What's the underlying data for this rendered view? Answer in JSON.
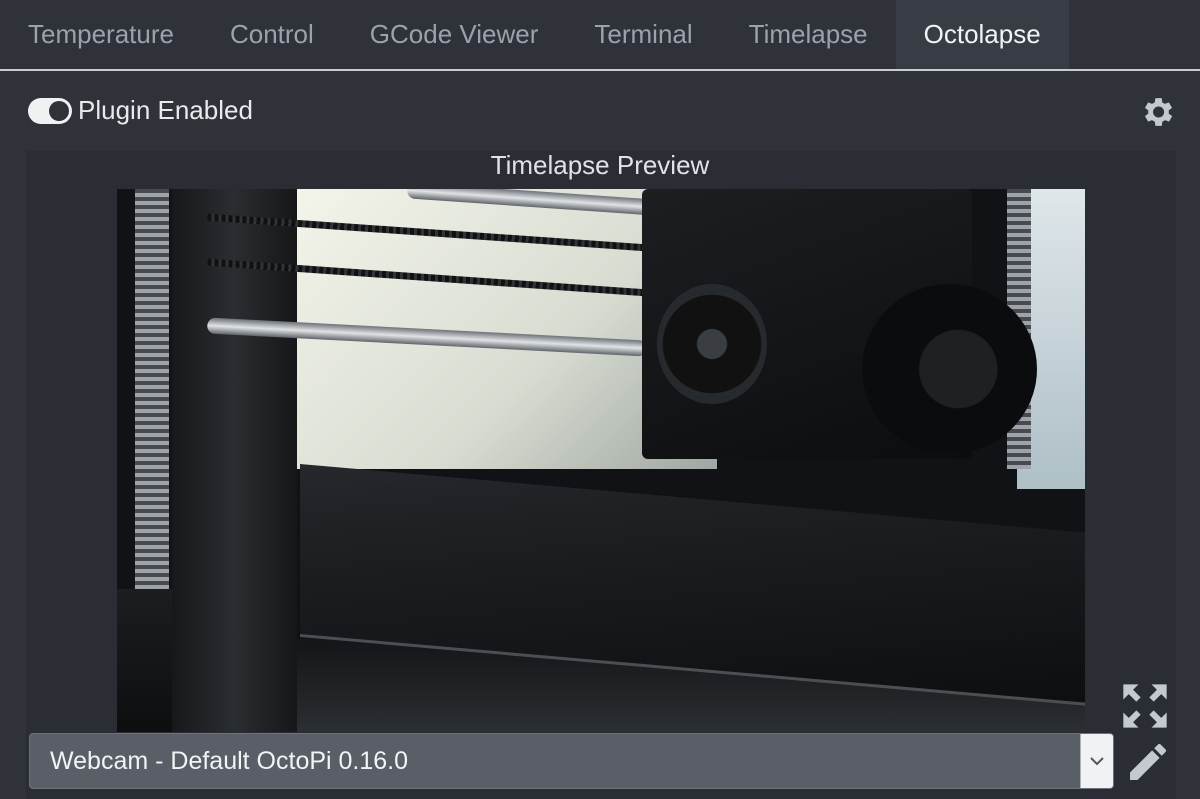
{
  "tabs": [
    {
      "label": "Temperature",
      "active": false
    },
    {
      "label": "Control",
      "active": false
    },
    {
      "label": "GCode Viewer",
      "active": false
    },
    {
      "label": "Terminal",
      "active": false
    },
    {
      "label": "Timelapse",
      "active": false
    },
    {
      "label": "Octolapse",
      "active": true
    }
  ],
  "toolbar": {
    "plugin_toggle_label": "Plugin Enabled",
    "plugin_enabled": true,
    "settings_icon": "gear-icon"
  },
  "preview": {
    "title": "Timelapse Preview"
  },
  "webcam": {
    "selected": "Webcam - Default OctoPi 0.16.0",
    "caret_icon": "chevron-down-icon"
  },
  "icons": {
    "fullscreen": "fullscreen-icon",
    "edit": "pencil-icon"
  },
  "colors": {
    "background": "#2f3238",
    "active_tab": "#383c44",
    "panel": "#2a2d33",
    "icon": "#c4c8cf"
  }
}
